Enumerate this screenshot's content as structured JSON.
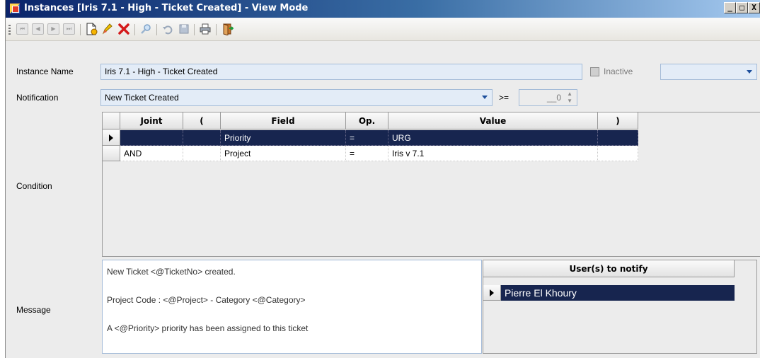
{
  "window": {
    "title": "Instances [Iris 7.1 - High - Ticket Created] - View Mode",
    "minimize": "_",
    "maximize": "□",
    "close": "X"
  },
  "toolbar": {
    "first": "⏮",
    "prev": "◀",
    "next": "▶",
    "last": "⏭",
    "icons": [
      "new-document-icon",
      "edit-pencil-icon",
      "delete-x-icon",
      "search-icon",
      "undo-icon",
      "save-icon",
      "print-icon",
      "exit-door-icon"
    ]
  },
  "form": {
    "instance_name_label": "Instance Name",
    "instance_name_value": "Iris 7.1 - High - Ticket Created",
    "inactive_label": "Inactive",
    "inactive_checked": false,
    "inactive_combo_value": "",
    "notification_label": "Notification",
    "notification_value": "New Ticket Created",
    "operator": ">=",
    "threshold_value": "__0",
    "condition_label": "Condition",
    "message_label": "Message"
  },
  "condition_grid": {
    "columns": [
      "Joint",
      "(",
      "Field",
      "Op.",
      "Value",
      ")"
    ],
    "rows": [
      {
        "joint": "",
        "open": "",
        "field": "Priority",
        "op": "=",
        "value": "URG",
        "close": "",
        "selected": true
      },
      {
        "joint": "AND",
        "open": "",
        "field": "Project",
        "op": "=",
        "value": "Iris v 7.1",
        "close": "",
        "selected": false
      }
    ]
  },
  "message": {
    "lines": [
      "New Ticket <@TicketNo> created.",
      "Project Code : <@Project> - Category <@Category>",
      "A <@Priority> priority  has been assigned to this ticket"
    ]
  },
  "users_grid": {
    "header": "User(s) to notify",
    "rows": [
      {
        "name": "Pierre El Khoury",
        "selected": true
      }
    ]
  },
  "colors": {
    "title_start": "#0a246a",
    "title_end": "#a6caf0",
    "selection": "#17254f",
    "field_bg": "#e3ecf7"
  }
}
